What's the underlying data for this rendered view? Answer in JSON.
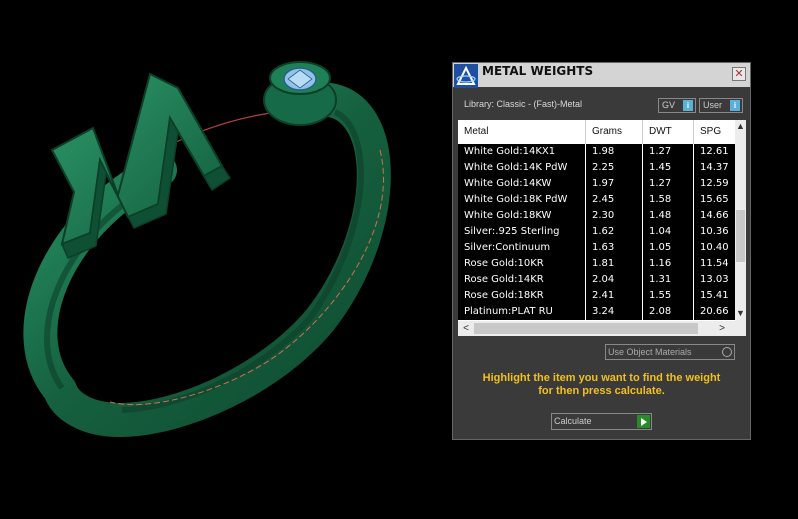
{
  "panel": {
    "title": "METAL WEIGHTS",
    "close_label": "✕",
    "library_label": "Library: Classic - (Fast)-Metal",
    "gv_label": "GV",
    "user_label": "User",
    "toggle_indicator": "i",
    "columns": [
      "Metal",
      "Grams",
      "DWT",
      "SPG"
    ],
    "rows": [
      {
        "metal": "White Gold:14KX1",
        "grams": "1.98",
        "dwt": "1.27",
        "spg": "12.61"
      },
      {
        "metal": "White Gold:14K PdW",
        "grams": "2.25",
        "dwt": "1.45",
        "spg": "14.37"
      },
      {
        "metal": "White Gold:14KW",
        "grams": "1.97",
        "dwt": "1.27",
        "spg": "12.59"
      },
      {
        "metal": "White Gold:18K PdW",
        "grams": "2.45",
        "dwt": "1.58",
        "spg": "15.65"
      },
      {
        "metal": "White Gold:18KW",
        "grams": "2.30",
        "dwt": "1.48",
        "spg": "14.66"
      },
      {
        "metal": "Silver:.925 Sterling",
        "grams": "1.62",
        "dwt": "1.04",
        "spg": "10.36"
      },
      {
        "metal": "Silver:Continuum",
        "grams": "1.63",
        "dwt": "1.05",
        "spg": "10.40"
      },
      {
        "metal": "Rose Gold:10KR",
        "grams": "1.81",
        "dwt": "1.16",
        "spg": "11.54"
      },
      {
        "metal": "Rose Gold:14KR",
        "grams": "2.04",
        "dwt": "1.31",
        "spg": "13.03"
      },
      {
        "metal": "Rose Gold:18KR",
        "grams": "2.41",
        "dwt": "1.55",
        "spg": "15.41"
      },
      {
        "metal": "Platinum:PLAT RU",
        "grams": "3.24",
        "dwt": "2.08",
        "spg": "20.66"
      }
    ],
    "use_object_materials": "Use Object Materials",
    "hint_line1": "Highlight the item you want to find the weight",
    "hint_line2": "for then press calculate.",
    "calculate_label": "Calculate",
    "scroll_up": "▲",
    "scroll_down": "▼",
    "scroll_left": "<",
    "scroll_right": ">"
  },
  "colors": {
    "viewport_bg": "#000000",
    "ring_green": "#1f7a55",
    "panel_bg": "#3a3a3a",
    "hint_yellow": "#f0c020",
    "calculate_green": "#2a8a2a",
    "toggle_blue": "#5ab0d8"
  },
  "icons": [
    "app-logo-icon",
    "close-icon",
    "radio-icon",
    "play-icon",
    "scroll-up-icon",
    "scroll-down-icon",
    "scroll-left-icon",
    "scroll-right-icon"
  ]
}
